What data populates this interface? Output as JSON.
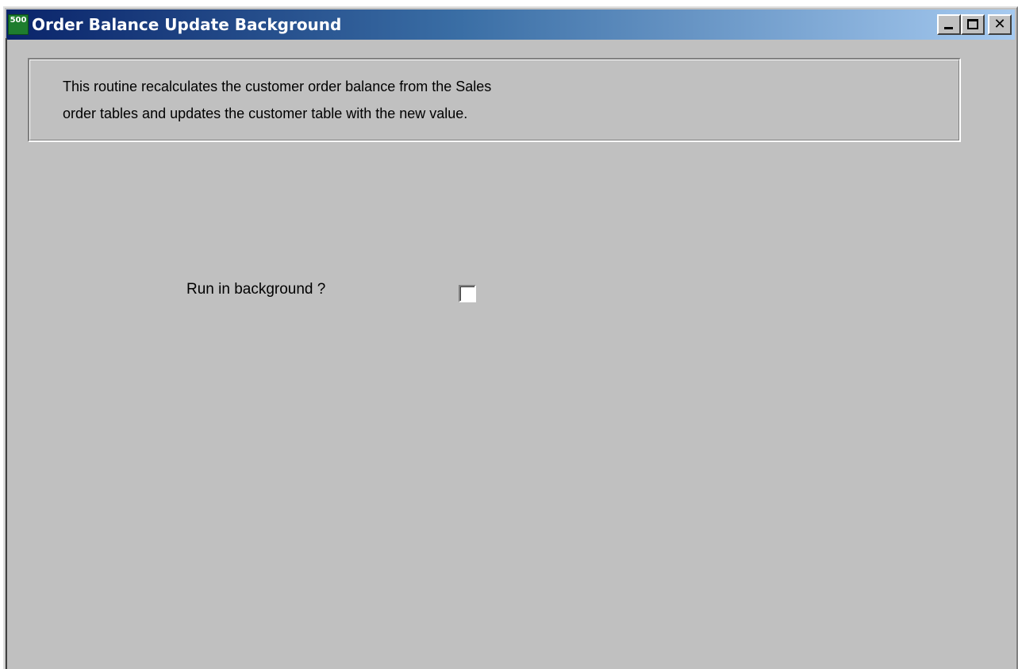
{
  "window": {
    "title": "Order Balance Update Background",
    "icon_text": "500",
    "icon_name": "app-500-icon",
    "titlebar_color_start": "#0a246a",
    "titlebar_color_end": "#a6caf0",
    "background": "#c0c0c0",
    "controls": {
      "minimize_icon": "minimize-icon",
      "maximize_icon": "maximize-icon",
      "close_icon": "close-icon",
      "close_glyph": "✕"
    }
  },
  "info_panel": {
    "line1": "This routine recalculates the customer order balance from the Sales",
    "line2": "order tables and updates the customer table with the new value."
  },
  "form": {
    "run_in_background_label": "Run in background ?",
    "run_in_background_checked": false
  }
}
